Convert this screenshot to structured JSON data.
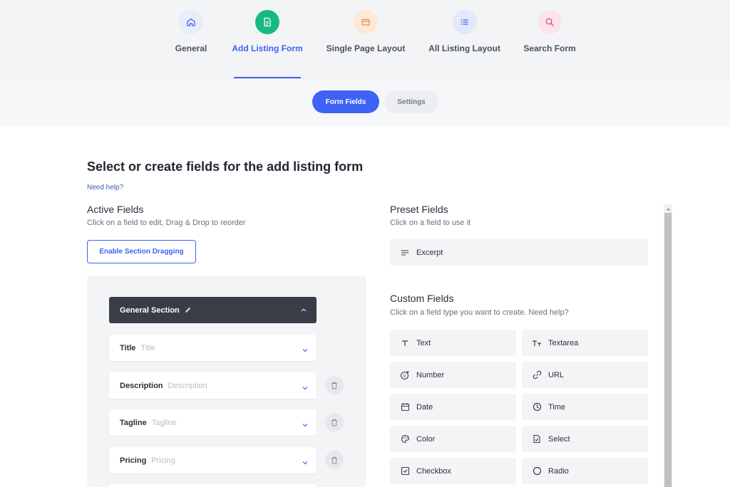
{
  "tabs": [
    {
      "label": "General",
      "icon": "home-icon",
      "bg": "#e8ecfb",
      "color": "#3e62f5"
    },
    {
      "label": "Add Listing Form",
      "icon": "form-icon",
      "bg": "#16b981",
      "color": "#ffffff"
    },
    {
      "label": "Single Page Layout",
      "icon": "layout-card-icon",
      "bg": "#fde9d8",
      "color": "#f08a3c"
    },
    {
      "label": "All Listing Layout",
      "icon": "list-icon",
      "bg": "#e3e9fb",
      "color": "#3e62f5"
    },
    {
      "label": "Search Form",
      "icon": "search-icon",
      "bg": "#fce4ec",
      "color": "#e0457b"
    }
  ],
  "subtabs": {
    "form_fields": "Form Fields",
    "settings": "Settings"
  },
  "page": {
    "title": "Select or create fields for the add listing form",
    "help": "Need help?"
  },
  "active": {
    "title": "Active Fields",
    "subtitle": "Click on a field to edit, Drag & Drop to reorder",
    "button": "Enable Section Dragging",
    "section": "General Section",
    "fields": [
      {
        "name": "Title",
        "placeholder": "Title"
      },
      {
        "name": "Description",
        "placeholder": "Description"
      },
      {
        "name": "Tagline",
        "placeholder": "Tagline"
      },
      {
        "name": "Pricing",
        "placeholder": "Pricing"
      }
    ]
  },
  "preset": {
    "title": "Preset Fields",
    "subtitle": "Click on a field to use it",
    "excerpt": "Excerpt"
  },
  "custom": {
    "title": "Custom Fields",
    "subtitle": "Click on a field type you want to create. Need help?",
    "items": [
      {
        "label": "Text",
        "icon": "text-icon"
      },
      {
        "label": "Textarea",
        "icon": "textarea-icon"
      },
      {
        "label": "Number",
        "icon": "number-icon"
      },
      {
        "label": "URL",
        "icon": "link-icon"
      },
      {
        "label": "Date",
        "icon": "calendar-icon"
      },
      {
        "label": "Time",
        "icon": "clock-icon"
      },
      {
        "label": "Color",
        "icon": "palette-icon"
      },
      {
        "label": "Select",
        "icon": "select-file-icon"
      },
      {
        "label": "Checkbox",
        "icon": "checkbox-icon"
      },
      {
        "label": "Radio",
        "icon": "radio-icon"
      }
    ]
  },
  "colors": {
    "accent": "#3e62f5",
    "dark_section": "#3a3d47"
  }
}
